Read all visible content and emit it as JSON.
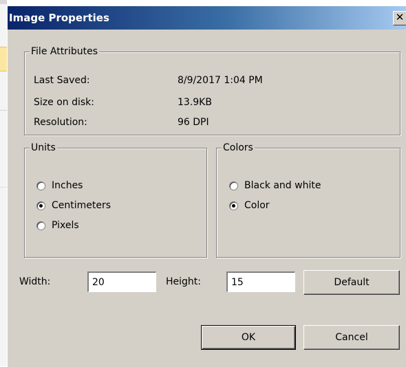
{
  "dialog": {
    "title": "Image Properties",
    "close_glyph": "✕"
  },
  "file_attributes": {
    "legend": "File Attributes",
    "rows": [
      {
        "label": "Last Saved:",
        "value": "8/9/2017 1:04 PM"
      },
      {
        "label": "Size on disk:",
        "value": "13.9KB"
      },
      {
        "label": "Resolution:",
        "value": "96 DPI"
      }
    ]
  },
  "units": {
    "legend": "Units",
    "options": [
      "Inches",
      "Centimeters",
      "Pixels"
    ],
    "selected": "Centimeters"
  },
  "colors": {
    "legend": "Colors",
    "options": [
      "Black and white",
      "Color"
    ],
    "selected": "Color"
  },
  "size": {
    "width_label": "Width:",
    "width_value": "20",
    "height_label": "Height:",
    "height_value": "15",
    "default_label": "Default"
  },
  "buttons": {
    "ok_label": "OK",
    "cancel_label": "Cancel"
  }
}
